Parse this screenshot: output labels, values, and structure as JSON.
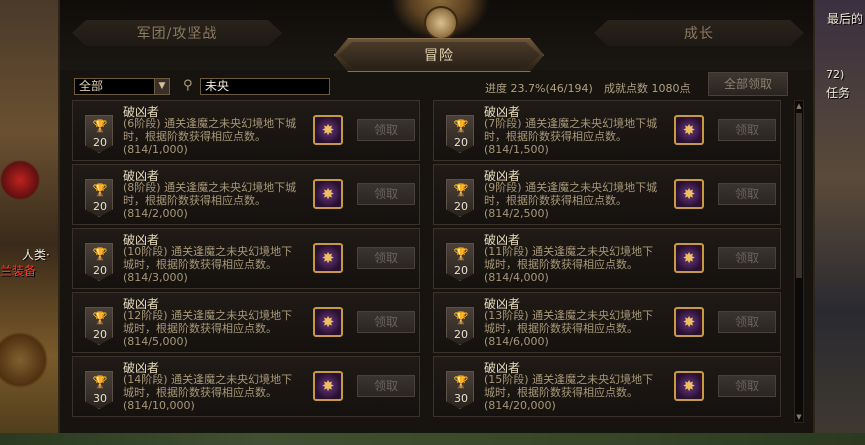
{
  "tabs": {
    "left": "军团/攻坚战",
    "center": "冒险",
    "right": "成长"
  },
  "filter": {
    "selected": "全部",
    "search_value": "未央"
  },
  "progress": {
    "label": "进度",
    "percent": "23.7%",
    "count": "(46/194)",
    "points_label": "成就点数",
    "points": "1080点"
  },
  "claim_all_label": "全部领取",
  "side": {
    "right_top": "最后的",
    "right_mid_num": "72)",
    "right_task": "任务",
    "left_name": "人类·",
    "left_equip": "兰装备"
  },
  "achievements": [
    {
      "title": "破凶者",
      "desc": "(6阶段) 通关逢魔之未央幻境地下城时，根据阶数获得相应点数。",
      "progress": "(814/1,000)",
      "tier": "20",
      "claim": "领取"
    },
    {
      "title": "破凶者",
      "desc": "(7阶段) 通关逢魔之未央幻境地下城时，根据阶数获得相应点数。",
      "progress": "(814/1,500)",
      "tier": "20",
      "claim": "领取"
    },
    {
      "title": "破凶者",
      "desc": "(8阶段) 通关逢魔之未央幻境地下城时，根据阶数获得相应点数。",
      "progress": "(814/2,000)",
      "tier": "20",
      "claim": "领取"
    },
    {
      "title": "破凶者",
      "desc": "(9阶段) 通关逢魔之未央幻境地下城时，根据阶数获得相应点数。",
      "progress": "(814/2,500)",
      "tier": "20",
      "claim": "领取"
    },
    {
      "title": "破凶者",
      "desc": "(10阶段) 通关逢魔之未央幻境地下城时，根据阶数获得相应点数。",
      "progress": "(814/3,000)",
      "tier": "20",
      "claim": "领取"
    },
    {
      "title": "破凶者",
      "desc": "(11阶段) 通关逢魔之未央幻境地下城时，根据阶数获得相应点数。",
      "progress": "(814/4,000)",
      "tier": "20",
      "claim": "领取"
    },
    {
      "title": "破凶者",
      "desc": "(12阶段) 通关逢魔之未央幻境地下城时，根据阶数获得相应点数。",
      "progress": "(814/5,000)",
      "tier": "20",
      "claim": "领取"
    },
    {
      "title": "破凶者",
      "desc": "(13阶段) 通关逢魔之未央幻境地下城时，根据阶数获得相应点数。",
      "progress": "(814/6,000)",
      "tier": "20",
      "claim": "领取"
    },
    {
      "title": "破凶者",
      "desc": "(14阶段) 通关逢魔之未央幻境地下城时，根据阶数获得相应点数。",
      "progress": "(814/10,000)",
      "tier": "30",
      "claim": "领取"
    },
    {
      "title": "破凶者",
      "desc": "(15阶段) 通关逢魔之未央幻境地下城时，根据阶数获得相应点数。",
      "progress": "(814/20,000)",
      "tier": "30",
      "claim": "领取"
    }
  ]
}
